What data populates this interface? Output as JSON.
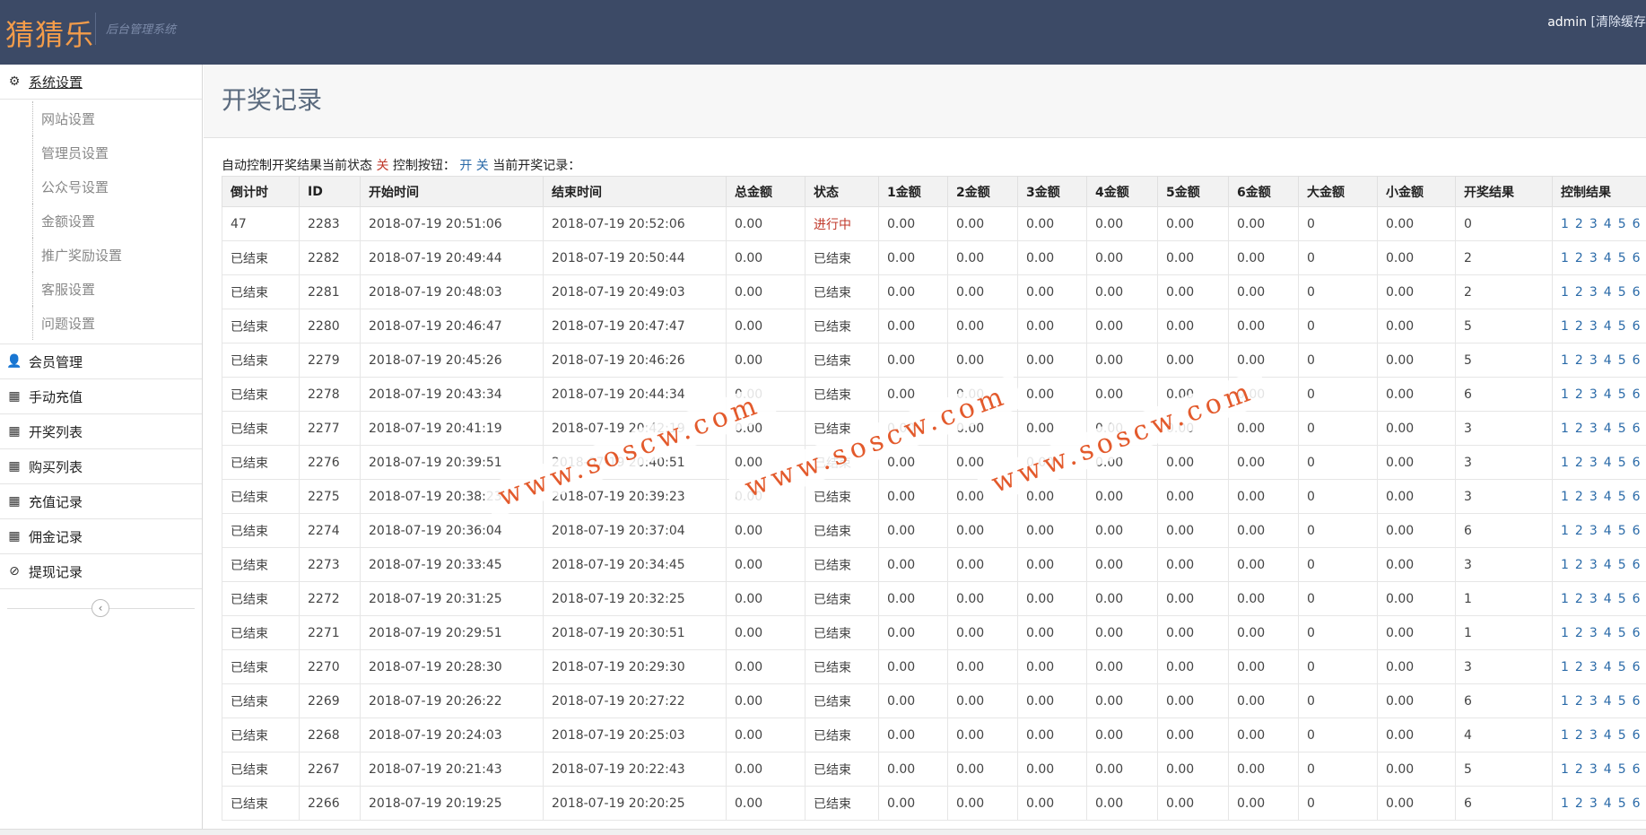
{
  "header": {
    "brand": "猜猜乐",
    "subtitle": "后台管理系统",
    "user": "admin",
    "clear_cache": "[清除缓存"
  },
  "sidebar": {
    "settings": {
      "label": "系统设置",
      "icon": "gear-icon"
    },
    "sub_items": [
      {
        "label": "网站设置"
      },
      {
        "label": "管理员设置"
      },
      {
        "label": "公众号设置"
      },
      {
        "label": "金额设置"
      },
      {
        "label": "推广奖励设置"
      },
      {
        "label": "客服设置"
      },
      {
        "label": "问题设置"
      }
    ],
    "items": [
      {
        "label": "会员管理",
        "icon": "user-icon"
      },
      {
        "label": "手动充值",
        "icon": "calendar-icon"
      },
      {
        "label": "开奖列表",
        "icon": "calendar-icon"
      },
      {
        "label": "购买列表",
        "icon": "calendar-icon"
      },
      {
        "label": "充值记录",
        "icon": "calendar-icon"
      },
      {
        "label": "佣金记录",
        "icon": "calendar-icon"
      },
      {
        "label": "提现记录",
        "icon": "ban-icon"
      }
    ]
  },
  "main": {
    "title": "开奖记录",
    "status": {
      "prefix": "自动控制开奖结果当前状态",
      "state": "关",
      "button_label": "控制按钮：",
      "toggle": "开 关",
      "current_label": "当前开奖记录："
    },
    "columns": [
      "倒计时",
      "ID",
      "开始时间",
      "结束时间",
      "总金额",
      "状态",
      "1金额",
      "2金额",
      "3金额",
      "4金额",
      "5金额",
      "6金额",
      "大金额",
      "小金额",
      "开奖结果",
      "控制结果"
    ],
    "control_options": [
      "1",
      "2",
      "3",
      "4",
      "5",
      "6"
    ],
    "rows": [
      {
        "countdown": "47",
        "id": "2283",
        "start": "2018-07-19 20:51:06",
        "end": "2018-07-19 20:52:06",
        "total": "0.00",
        "status": "进行中",
        "a1": "0.00",
        "a2": "0.00",
        "a3": "0.00",
        "a4": "0.00",
        "a5": "0.00",
        "a6": "0.00",
        "big": "0",
        "small": "0.00",
        "result": "0"
      },
      {
        "countdown": "已结束",
        "id": "2282",
        "start": "2018-07-19 20:49:44",
        "end": "2018-07-19 20:50:44",
        "total": "0.00",
        "status": "已结束",
        "a1": "0.00",
        "a2": "0.00",
        "a3": "0.00",
        "a4": "0.00",
        "a5": "0.00",
        "a6": "0.00",
        "big": "0",
        "small": "0.00",
        "result": "2"
      },
      {
        "countdown": "已结束",
        "id": "2281",
        "start": "2018-07-19 20:48:03",
        "end": "2018-07-19 20:49:03",
        "total": "0.00",
        "status": "已结束",
        "a1": "0.00",
        "a2": "0.00",
        "a3": "0.00",
        "a4": "0.00",
        "a5": "0.00",
        "a6": "0.00",
        "big": "0",
        "small": "0.00",
        "result": "2"
      },
      {
        "countdown": "已结束",
        "id": "2280",
        "start": "2018-07-19 20:46:47",
        "end": "2018-07-19 20:47:47",
        "total": "0.00",
        "status": "已结束",
        "a1": "0.00",
        "a2": "0.00",
        "a3": "0.00",
        "a4": "0.00",
        "a5": "0.00",
        "a6": "0.00",
        "big": "0",
        "small": "0.00",
        "result": "5"
      },
      {
        "countdown": "已结束",
        "id": "2279",
        "start": "2018-07-19 20:45:26",
        "end": "2018-07-19 20:46:26",
        "total": "0.00",
        "status": "已结束",
        "a1": "0.00",
        "a2": "0.00",
        "a3": "0.00",
        "a4": "0.00",
        "a5": "0.00",
        "a6": "0.00",
        "big": "0",
        "small": "0.00",
        "result": "5"
      },
      {
        "countdown": "已结束",
        "id": "2278",
        "start": "2018-07-19 20:43:34",
        "end": "2018-07-19 20:44:34",
        "total": "0.00",
        "status": "已结束",
        "a1": "0.00",
        "a2": "0.00",
        "a3": "0.00",
        "a4": "0.00",
        "a5": "0.00",
        "a6": "0.00",
        "big": "0",
        "small": "0.00",
        "result": "6"
      },
      {
        "countdown": "已结束",
        "id": "2277",
        "start": "2018-07-19 20:41:19",
        "end": "2018-07-19 20:42:19",
        "total": "0.00",
        "status": "已结束",
        "a1": "0.00",
        "a2": "0.00",
        "a3": "0.00",
        "a4": "0.00",
        "a5": "0.00",
        "a6": "0.00",
        "big": "0",
        "small": "0.00",
        "result": "3"
      },
      {
        "countdown": "已结束",
        "id": "2276",
        "start": "2018-07-19 20:39:51",
        "end": "2018-07-19 20:40:51",
        "total": "0.00",
        "status": "已结束",
        "a1": "0.00",
        "a2": "0.00",
        "a3": "0.00",
        "a4": "0.00",
        "a5": "0.00",
        "a6": "0.00",
        "big": "0",
        "small": "0.00",
        "result": "3"
      },
      {
        "countdown": "已结束",
        "id": "2275",
        "start": "2018-07-19 20:38:23",
        "end": "2018-07-19 20:39:23",
        "total": "0.00",
        "status": "已结束",
        "a1": "0.00",
        "a2": "0.00",
        "a3": "0.00",
        "a4": "0.00",
        "a5": "0.00",
        "a6": "0.00",
        "big": "0",
        "small": "0.00",
        "result": "3"
      },
      {
        "countdown": "已结束",
        "id": "2274",
        "start": "2018-07-19 20:36:04",
        "end": "2018-07-19 20:37:04",
        "total": "0.00",
        "status": "已结束",
        "a1": "0.00",
        "a2": "0.00",
        "a3": "0.00",
        "a4": "0.00",
        "a5": "0.00",
        "a6": "0.00",
        "big": "0",
        "small": "0.00",
        "result": "6"
      },
      {
        "countdown": "已结束",
        "id": "2273",
        "start": "2018-07-19 20:33:45",
        "end": "2018-07-19 20:34:45",
        "total": "0.00",
        "status": "已结束",
        "a1": "0.00",
        "a2": "0.00",
        "a3": "0.00",
        "a4": "0.00",
        "a5": "0.00",
        "a6": "0.00",
        "big": "0",
        "small": "0.00",
        "result": "3"
      },
      {
        "countdown": "已结束",
        "id": "2272",
        "start": "2018-07-19 20:31:25",
        "end": "2018-07-19 20:32:25",
        "total": "0.00",
        "status": "已结束",
        "a1": "0.00",
        "a2": "0.00",
        "a3": "0.00",
        "a4": "0.00",
        "a5": "0.00",
        "a6": "0.00",
        "big": "0",
        "small": "0.00",
        "result": "1"
      },
      {
        "countdown": "已结束",
        "id": "2271",
        "start": "2018-07-19 20:29:51",
        "end": "2018-07-19 20:30:51",
        "total": "0.00",
        "status": "已结束",
        "a1": "0.00",
        "a2": "0.00",
        "a3": "0.00",
        "a4": "0.00",
        "a5": "0.00",
        "a6": "0.00",
        "big": "0",
        "small": "0.00",
        "result": "1"
      },
      {
        "countdown": "已结束",
        "id": "2270",
        "start": "2018-07-19 20:28:30",
        "end": "2018-07-19 20:29:30",
        "total": "0.00",
        "status": "已结束",
        "a1": "0.00",
        "a2": "0.00",
        "a3": "0.00",
        "a4": "0.00",
        "a5": "0.00",
        "a6": "0.00",
        "big": "0",
        "small": "0.00",
        "result": "3"
      },
      {
        "countdown": "已结束",
        "id": "2269",
        "start": "2018-07-19 20:26:22",
        "end": "2018-07-19 20:27:22",
        "total": "0.00",
        "status": "已结束",
        "a1": "0.00",
        "a2": "0.00",
        "a3": "0.00",
        "a4": "0.00",
        "a5": "0.00",
        "a6": "0.00",
        "big": "0",
        "small": "0.00",
        "result": "6"
      },
      {
        "countdown": "已结束",
        "id": "2268",
        "start": "2018-07-19 20:24:03",
        "end": "2018-07-19 20:25:03",
        "total": "0.00",
        "status": "已结束",
        "a1": "0.00",
        "a2": "0.00",
        "a3": "0.00",
        "a4": "0.00",
        "a5": "0.00",
        "a6": "0.00",
        "big": "0",
        "small": "0.00",
        "result": "4"
      },
      {
        "countdown": "已结束",
        "id": "2267",
        "start": "2018-07-19 20:21:43",
        "end": "2018-07-19 20:22:43",
        "total": "0.00",
        "status": "已结束",
        "a1": "0.00",
        "a2": "0.00",
        "a3": "0.00",
        "a4": "0.00",
        "a5": "0.00",
        "a6": "0.00",
        "big": "0",
        "small": "0.00",
        "result": "5"
      },
      {
        "countdown": "已结束",
        "id": "2266",
        "start": "2018-07-19 20:19:25",
        "end": "2018-07-19 20:20:25",
        "total": "0.00",
        "status": "已结束",
        "a1": "0.00",
        "a2": "0.00",
        "a3": "0.00",
        "a4": "0.00",
        "a5": "0.00",
        "a6": "0.00",
        "big": "0",
        "small": "0.00",
        "result": "6"
      }
    ]
  },
  "watermark": {
    "text": "www.soscw.com"
  },
  "colors": {
    "header_bg": "#3c4a66",
    "brand": "#f39c4a",
    "link": "#2a6aa8",
    "running": "#c0392b",
    "watermark": "#e35a2c"
  }
}
